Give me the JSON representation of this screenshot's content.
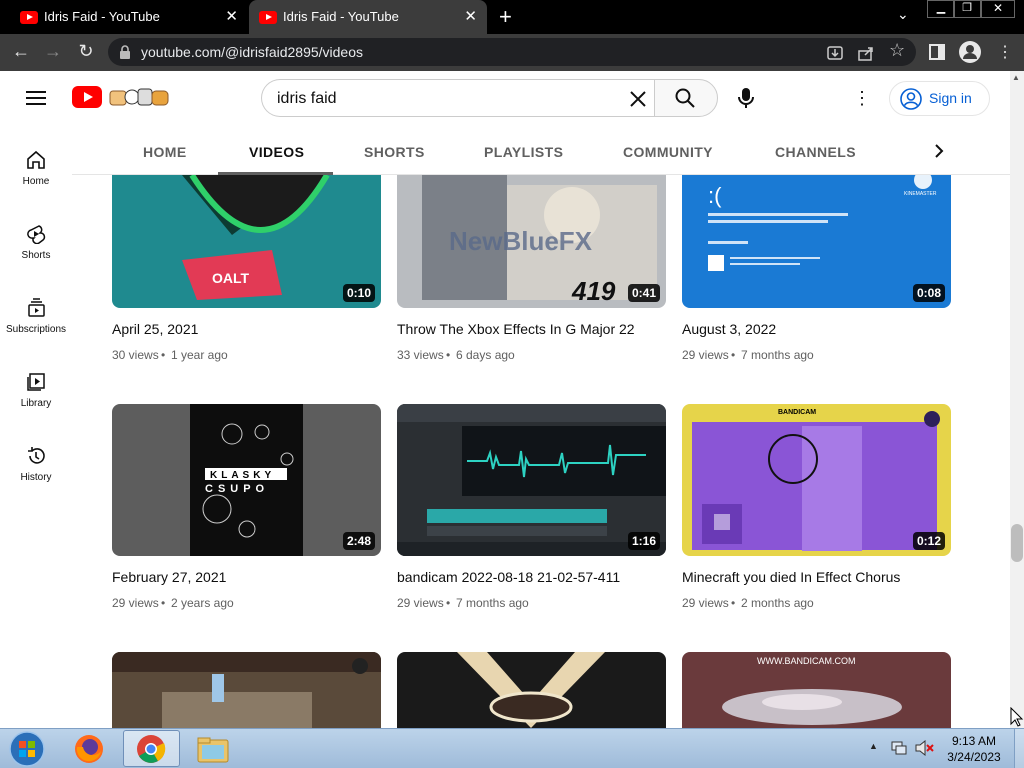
{
  "browser": {
    "tabs": [
      {
        "title": "Idris Faid - YouTube"
      },
      {
        "title": "Idris Faid - YouTube"
      }
    ],
    "url": "youtube.com/@idrisfaid2895/videos"
  },
  "youtube": {
    "search_value": "idris faid",
    "signin_label": "Sign in",
    "sidebar": [
      {
        "label": "Home",
        "icon": "home-icon"
      },
      {
        "label": "Shorts",
        "icon": "shorts-icon"
      },
      {
        "label": "Subscriptions",
        "icon": "subscriptions-icon"
      },
      {
        "label": "Library",
        "icon": "library-icon"
      },
      {
        "label": "History",
        "icon": "history-icon"
      }
    ],
    "channel_tabs": [
      "HOME",
      "VIDEOS",
      "SHORTS",
      "PLAYLISTS",
      "COMMUNITY",
      "CHANNELS"
    ],
    "videos": [
      {
        "title": "April 25, 2021",
        "views": "30 views",
        "age": "1 year ago",
        "duration": "0:10",
        "color": "#1f8a8f"
      },
      {
        "title": "Throw The Xbox Effects In G Major 22",
        "views": "33 views",
        "age": "6 days ago",
        "duration": "0:41",
        "color": "#b9bcc0"
      },
      {
        "title": "August 3, 2022",
        "views": "29 views",
        "age": "7 months ago",
        "duration": "0:08",
        "color": "#1a7ad4"
      },
      {
        "title": "February 27, 2021",
        "views": "29 views",
        "age": "2 years ago",
        "duration": "2:48",
        "color": "#3a3a3a"
      },
      {
        "title": "bandicam 2022-08-18 21-02-57-411",
        "views": "29 views",
        "age": "7 months ago",
        "duration": "1:16",
        "color": "#2b2f33"
      },
      {
        "title": "Minecraft you died In Effect Chorus",
        "views": "29 views",
        "age": "2 months ago",
        "duration": "0:12",
        "color": "#8a55d6"
      },
      {
        "title": "",
        "views": "",
        "age": "",
        "duration": "",
        "color": "#5a4a3a"
      },
      {
        "title": "",
        "views": "",
        "age": "",
        "duration": "",
        "color": "#1a1a1a"
      },
      {
        "title": "",
        "views": "",
        "age": "",
        "duration": "",
        "color": "#6a3a3c"
      }
    ],
    "thumb_text": {
      "bluefx": "NewBlueFX",
      "num419": "419",
      "sad": ":(",
      "kinemaster": "KINEMASTER",
      "klasky": "KLASKY",
      "csupo": "CSUPO",
      "bandicam": "WWW.BANDICAM.COM"
    }
  },
  "taskbar": {
    "time": "9:13 AM",
    "date": "3/24/2023"
  }
}
